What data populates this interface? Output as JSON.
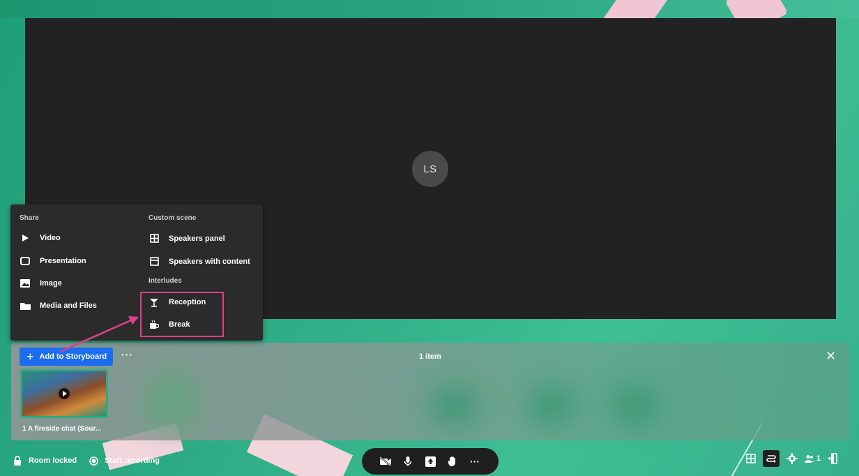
{
  "stage": {
    "avatar_initials": "LS"
  },
  "menu": {
    "share_heading": "Share",
    "custom_scene_heading": "Custom scene",
    "interludes_heading": "Interludes",
    "share_items": [
      {
        "label": "Video",
        "icon": "play-icon"
      },
      {
        "label": "Presentation",
        "icon": "presentation-icon"
      },
      {
        "label": "Image",
        "icon": "image-icon"
      },
      {
        "label": "Media and Files",
        "icon": "folder-icon"
      }
    ],
    "custom_scene_items": [
      {
        "label": "Speakers panel",
        "icon": "grid-icon"
      },
      {
        "label": "Speakers with content",
        "icon": "layout-icon"
      }
    ],
    "interlude_items": [
      {
        "label": "Reception",
        "icon": "cocktail-icon"
      },
      {
        "label": "Break",
        "icon": "coffee-icon"
      }
    ]
  },
  "storyboard": {
    "add_label": "Add to Storyboard",
    "more_label": "···",
    "count_label": "1 item",
    "close_label": "✕",
    "items": [
      {
        "label": "1 A fireside chat (Sour..."
      }
    ]
  },
  "bottombar": {
    "room_locked": "Room locked",
    "start_recording": "Start recording",
    "participant_count": "1",
    "more_label": "···"
  },
  "colors": {
    "accent": "#1a6cf0",
    "highlight": "#e0408a",
    "stage": "#222222",
    "menu": "#2b2b2b"
  }
}
